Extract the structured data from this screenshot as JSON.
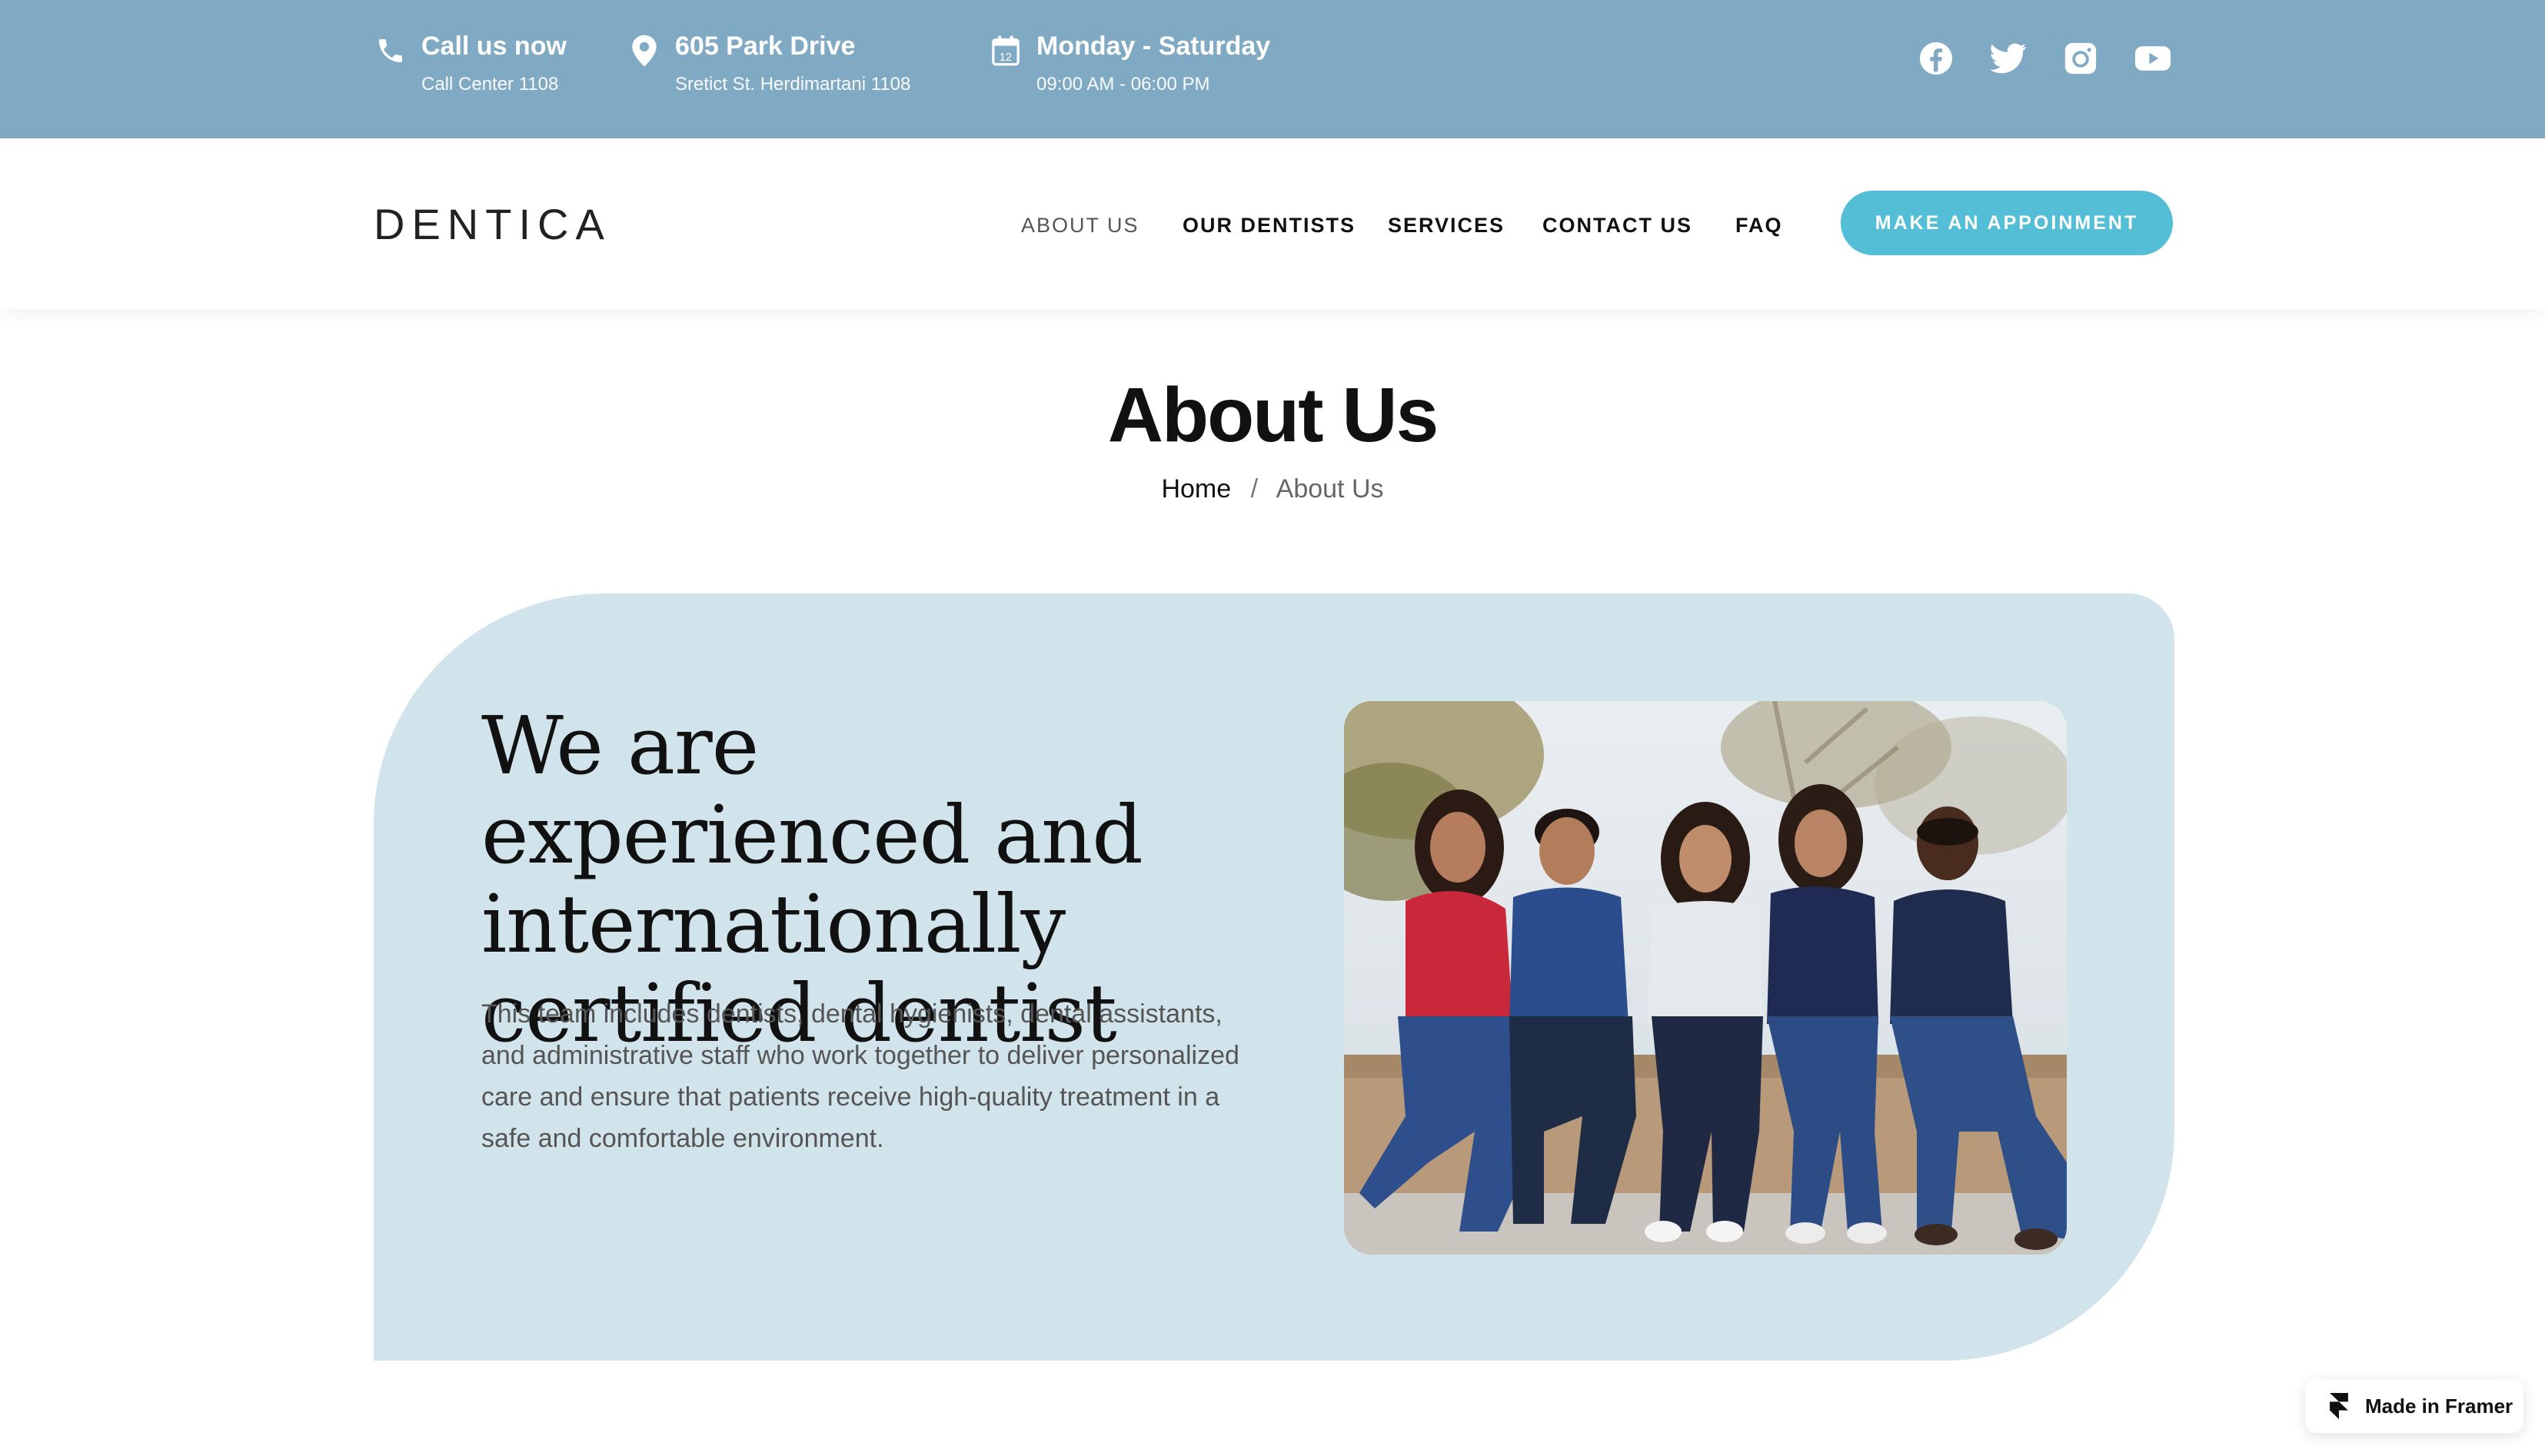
{
  "topbar": {
    "call": {
      "title": "Call us now",
      "sub": "Call Center 1108",
      "icon": "phone-icon"
    },
    "address": {
      "title": "605 Park Drive",
      "sub": "Sretict St. Herdimartani 1108",
      "icon": "map-pin-icon"
    },
    "hours": {
      "title": "Monday - Saturday",
      "sub": "09:00 AM - 06:00 PM",
      "icon": "calendar-icon",
      "calendar_day": "12"
    },
    "social": [
      "facebook-icon",
      "twitter-icon",
      "instagram-icon",
      "youtube-icon"
    ]
  },
  "nav": {
    "logo": "DENTICA",
    "items": [
      "ABOUT US",
      "OUR DENTISTS",
      "SERVICES",
      "CONTACT US",
      "FAQ"
    ],
    "active": "ABOUT US",
    "cta": "MAKE AN APPOINMENT"
  },
  "page": {
    "title": "About Us",
    "breadcrumb": {
      "home": "Home",
      "separator": "/",
      "current": "About Us"
    }
  },
  "hero": {
    "headline": "We are experienced and internationally certified dentist",
    "description": "This team includes dentists, dental hygienists, dental assistants, and administrative staff who work together to deliver personalized care and ensure that patients receive high-quality treatment in a safe and comfortable environment."
  },
  "badge": {
    "text": "Made in Framer"
  },
  "colors": {
    "topbar": "#80a9c4",
    "accent": "#55bed7",
    "card": "#d2e4eb",
    "text": "#111111",
    "muted": "#555555"
  }
}
